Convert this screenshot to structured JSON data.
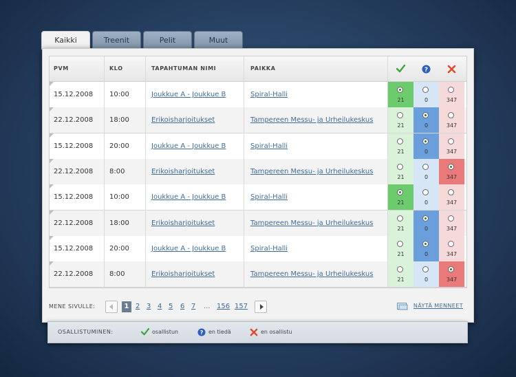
{
  "tabs": [
    "Kaikki",
    "Treenit",
    "Pelit",
    "Muut"
  ],
  "columns": {
    "date": "PVM",
    "time": "KLO",
    "name": "TAPAHTUMAN NIMI",
    "place": "PAIKKA"
  },
  "option_icons": [
    "check-icon",
    "question-icon",
    "x-icon"
  ],
  "colors": {
    "yes": "#6ccb6c",
    "yes_light": "#daf2da",
    "maybe": "#6a9fdc",
    "maybe_light": "#d7e6f6",
    "no": "#ea7a7a",
    "no_light": "#f6dada",
    "link": "#3f6c98"
  },
  "rows": [
    {
      "date": "15.12.2008",
      "time": "10:00",
      "name": "Joukkue A - Joukkue B",
      "place": "Spiral-Halli",
      "selected": 0,
      "counts": [
        "21",
        "0",
        "347"
      ]
    },
    {
      "date": "22.12.2008",
      "time": "18:00",
      "name": "Erikoisharjoitukset",
      "place": "Tampereen Messu- ja Urheilukeskus",
      "selected": 1,
      "counts": [
        "21",
        "0",
        "347"
      ]
    },
    {
      "date": "15.12.2008",
      "time": "20:00",
      "name": "Joukkue A - Joukkue B",
      "place": "Spiral-Halli",
      "selected": 1,
      "counts": [
        "21",
        "0",
        "347"
      ]
    },
    {
      "date": "22.12.2008",
      "time": "8:00",
      "name": "Erikoisharjoitukset",
      "place": "Tampereen Messu- ja Urheilukeskus",
      "selected": 2,
      "counts": [
        "21",
        "0",
        "347"
      ]
    },
    {
      "date": "15.12.2008",
      "time": "10:00",
      "name": "Joukkue A - Joukkue B",
      "place": "Spiral-Halli",
      "selected": 0,
      "counts": [
        "21",
        "0",
        "347"
      ]
    },
    {
      "date": "22.12.2008",
      "time": "18:00",
      "name": "Erikoisharjoitukset",
      "place": "Tampereen Messu- ja Urheilukeskus",
      "selected": 1,
      "counts": [
        "21",
        "0",
        "347"
      ]
    },
    {
      "date": "15.12.2008",
      "time": "20:00",
      "name": "Joukkue A - Joukkue B",
      "place": "Spiral-Halli",
      "selected": 1,
      "counts": [
        "21",
        "0",
        "347"
      ]
    },
    {
      "date": "22.12.2008",
      "time": "8:00",
      "name": "Erikoisharjoitukset",
      "place": "Tampereen Messu- ja Urheilukeskus",
      "selected": 2,
      "counts": [
        "21",
        "0",
        "347"
      ]
    }
  ],
  "pager": {
    "label": "MENE SIVULLE:",
    "pages": [
      "1",
      "2",
      "3",
      "4",
      "5",
      "6",
      "7",
      "...",
      "156",
      "157"
    ],
    "current": "1",
    "show_old": "NÄYTÄ MENNEET"
  },
  "legend": {
    "title": "OSALLISTUMINEN:",
    "yes": "osallistun",
    "maybe": "en tiedä",
    "no": "en osallistu"
  }
}
